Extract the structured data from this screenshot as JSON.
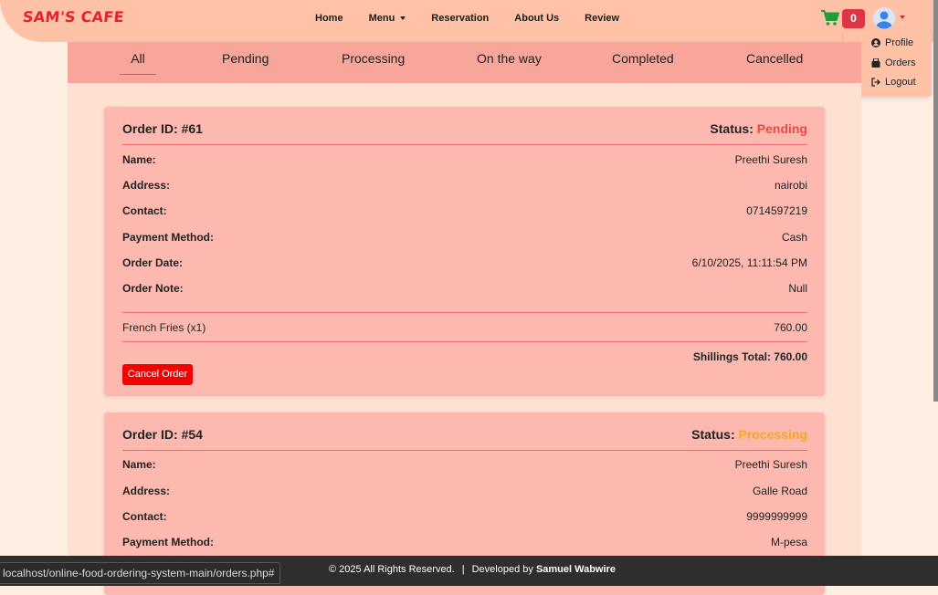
{
  "brand": "SAM'S CAFE",
  "nav": {
    "home": "Home",
    "menu": "Menu",
    "reservation": "Reservation",
    "about": "About Us",
    "review": "Review"
  },
  "cart": {
    "count": "0"
  },
  "dropdown": {
    "profile": "Profile",
    "orders": "Orders",
    "logout": "Logout"
  },
  "tabs": [
    "All",
    "Pending",
    "Processing",
    "On the way",
    "Completed",
    "Cancelled"
  ],
  "labels": {
    "status": "Status:",
    "name": "Name:",
    "address": "Address:",
    "contact": "Contact:",
    "payment": "Payment Method:",
    "order_date": "Order Date:",
    "order_note": "Order Note:",
    "cancel": "Cancel Order"
  },
  "orders": [
    {
      "id": "Order ID: #61",
      "status": "Pending",
      "name": "Preethi Suresh",
      "address": "nairobi",
      "contact": "0714597219",
      "payment": "Cash",
      "date": "6/10/2025, 11:11:54 PM",
      "note": "Null",
      "item": "French Fries (x1)",
      "item_price": "760.00",
      "total": "Shillings Total: 760.00"
    },
    {
      "id": "Order ID: #54",
      "status": "Processing",
      "name": "Preethi Suresh",
      "address": "Galle Road",
      "contact": "9999999999",
      "payment": "M-pesa"
    }
  ],
  "footer": {
    "copyright": "© 2025 All Rights Reserved.",
    "separator": "|",
    "dev_prefix": "Developed by",
    "dev_name": "Samuel Wabwire"
  },
  "status_bar_url": "localhost/online-food-ordering-system-main/orders.php#",
  "colors": {
    "navbar": "#ffc2a6",
    "tabs": "#f9a69a",
    "card": "#fdb9b0",
    "pending": "#f0483e",
    "processing": "#f5a623",
    "cancel_button": "#f50000",
    "cart_badge": "#dc3545"
  }
}
